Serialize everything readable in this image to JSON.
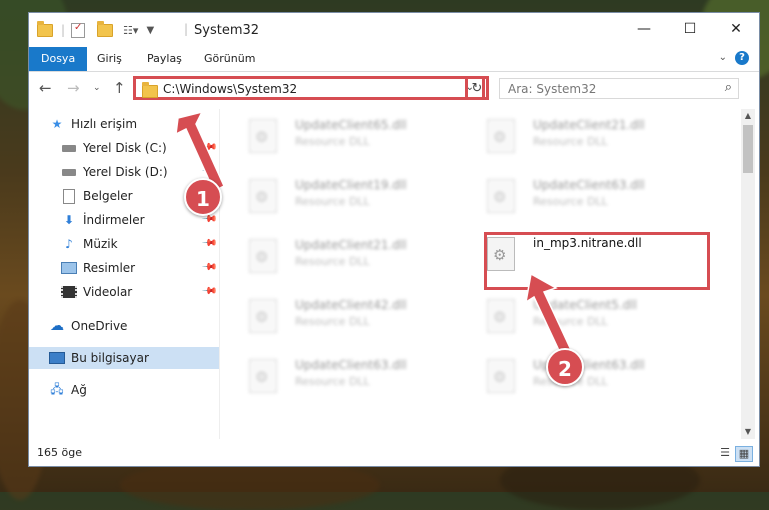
{
  "window": {
    "title": "System32",
    "controls": {
      "minimize": "—",
      "maximize": "☐",
      "close": "✕"
    }
  },
  "ribbon": {
    "tabs": [
      {
        "label": "Dosya",
        "active": true
      },
      {
        "label": "Giriş"
      },
      {
        "label": "Paylaş"
      },
      {
        "label": "Görünüm"
      }
    ],
    "help": "?"
  },
  "navbar": {
    "address_path": "C:\\Windows\\System32",
    "search_placeholder": "Ara: System32"
  },
  "sidebar": {
    "items": [
      {
        "label": "Hızlı erişim",
        "icon": "star-icon"
      },
      {
        "label": "Yerel Disk (C:)",
        "icon": "drive-icon",
        "pinned": true
      },
      {
        "label": "Yerel Disk (D:)",
        "icon": "drive-icon",
        "pinned": true
      },
      {
        "label": "Belgeler",
        "icon": "document-icon",
        "pinned": true
      },
      {
        "label": "İndirmeler",
        "icon": "download-icon",
        "pinned": true
      },
      {
        "label": "Müzik",
        "icon": "music-icon",
        "pinned": true
      },
      {
        "label": "Resimler",
        "icon": "picture-icon",
        "pinned": true
      },
      {
        "label": "Videolar",
        "icon": "video-icon",
        "pinned": true
      },
      {
        "label": "OneDrive",
        "icon": "cloud-icon"
      },
      {
        "label": "Bu bilgisayar",
        "icon": "computer-icon",
        "selected": true
      },
      {
        "label": "Ağ",
        "icon": "network-icon"
      }
    ]
  },
  "files": [
    {
      "name": "UpdateClient65.dll",
      "type": "Resource DLL"
    },
    {
      "name": "UpdateClient21.dll",
      "type": "Resource DLL"
    },
    {
      "name": "UpdateClient19.dll",
      "type": "Resource DLL"
    },
    {
      "name": "UpdateClient63.dll",
      "type": "Resource DLL"
    },
    {
      "name": "UpdateClient21.dll",
      "type": "Resource DLL"
    },
    {
      "name": "in_mp3.nitrane.dll",
      "type": "",
      "highlighted": true
    },
    {
      "name": "UpdateClient42.dll",
      "type": "Resource DLL"
    },
    {
      "name": "UpdateClient5.dll",
      "type": "Resource DLL"
    },
    {
      "name": "UpdateClient63.dll",
      "type": "Resource DLL"
    },
    {
      "name": "UpdateClient63.dll",
      "type": "Resource DLL"
    }
  ],
  "status": {
    "item_count": "165 öge"
  },
  "annotations": {
    "badge1": "1",
    "badge2": "2",
    "color": "#d64d52"
  }
}
